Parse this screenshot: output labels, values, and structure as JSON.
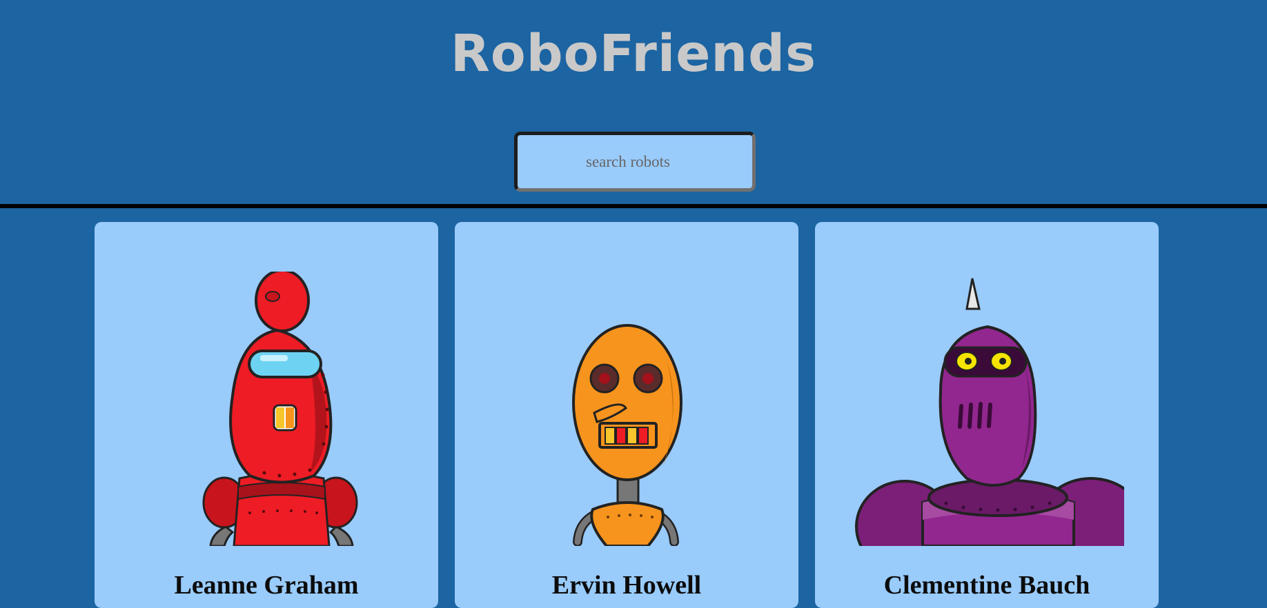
{
  "app": {
    "title": "RoboFriends"
  },
  "search": {
    "placeholder": "search robots",
    "value": ""
  },
  "robots": [
    {
      "name": "Leanne Graham",
      "color": "#ee1c25"
    },
    {
      "name": "Ervin Howell",
      "color": "#f7941d"
    },
    {
      "name": "Clementine Bauch",
      "color": "#92278f"
    }
  ],
  "colors": {
    "background": "#1c64a2",
    "card": "#99cbfb",
    "title": "#c9c9c9"
  }
}
